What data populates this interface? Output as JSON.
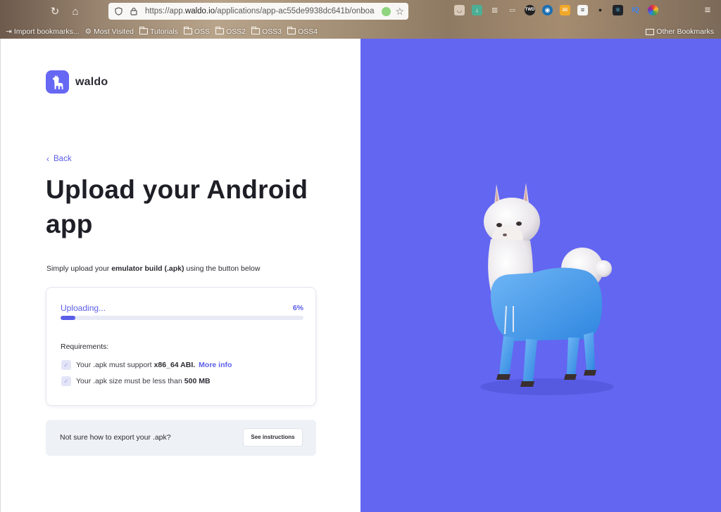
{
  "browser": {
    "url_prefix": "https://app.",
    "url_domain": "waldo.io",
    "url_rest": "/applications/app-ac55de9938dc641b/onboa",
    "bookmarks": [
      "Import bookmarks...",
      "Most Visited",
      "Tutorials",
      "OSS",
      "OSS2",
      "OSS3",
      "OSS4"
    ],
    "other_bookmarks": "Other Bookmarks"
  },
  "brand": {
    "name": "waldo",
    "accent": "#6366f1"
  },
  "page": {
    "back_label": "Back",
    "title": "Upload your Android app",
    "subtitle_prefix": "Simply upload your ",
    "subtitle_bold": "emulator build (.apk)",
    "subtitle_suffix": " using the button below"
  },
  "upload": {
    "status": "Uploading...",
    "percent_label": "6%",
    "progress_fraction": 0.06,
    "requirements_title": "Requirements:",
    "requirements": [
      {
        "prefix": "Your .apk must support",
        "bold": "x86_64 ABI.",
        "link": "More info"
      },
      {
        "prefix": "Your .apk size must be less than",
        "bold": "500 MB",
        "link": ""
      }
    ]
  },
  "help": {
    "text": "Not sure how to export your .apk?",
    "button_label": "See instructions"
  }
}
